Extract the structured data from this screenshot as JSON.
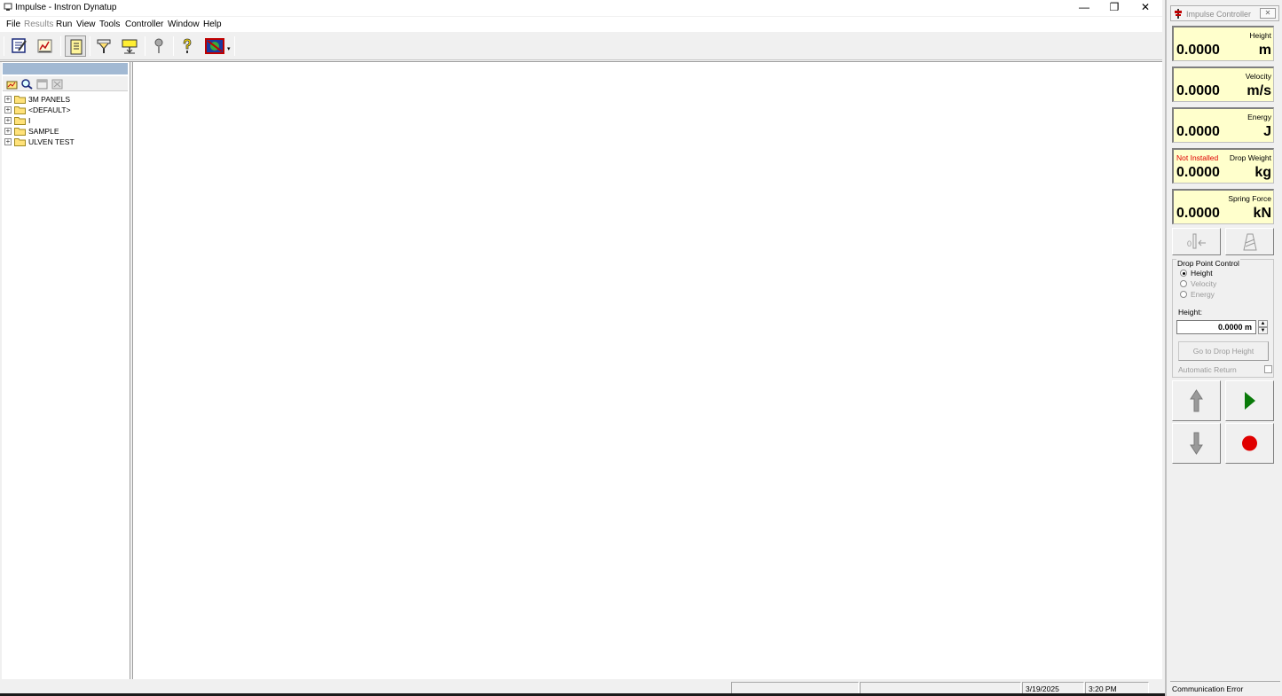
{
  "window": {
    "title": "Impulse - Instron Dynatup",
    "minimize_glyph": "—",
    "restore_glyph": "❐",
    "close_glyph": "✕"
  },
  "menu": {
    "items": [
      "File",
      "Results",
      "Run",
      "View",
      "Tools",
      "Controller",
      "Window",
      "Help"
    ]
  },
  "toolbar": {
    "icons": [
      "edit-method-icon",
      "chart-icon",
      "tree-view-icon",
      "filter-icon",
      "data-transfer-icon",
      "key-icon",
      "help-icon",
      "network-icon"
    ]
  },
  "tree": {
    "items": [
      {
        "label": "3M PANELS"
      },
      {
        "label": "<DEFAULT>"
      },
      {
        "label": "I"
      },
      {
        "label": "SAMPLE"
      },
      {
        "label": "ULVEN TEST"
      }
    ]
  },
  "statusbar": {
    "date": "3/19/2025",
    "time": "3:20 PM"
  },
  "controller": {
    "title": "Impulse Controller",
    "close_glyph": "✕",
    "readouts": [
      {
        "label": "Height",
        "value": "0.0000",
        "unit": "m",
        "status": ""
      },
      {
        "label": "Velocity",
        "value": "0.0000",
        "unit": "m/s",
        "status": ""
      },
      {
        "label": "Energy",
        "value": "0.0000",
        "unit": "J",
        "status": ""
      },
      {
        "label": "Drop Weight",
        "value": "0.0000",
        "unit": "kg",
        "status": "Not Installed"
      },
      {
        "label": "Spring Force",
        "value": "0.0000",
        "unit": "kN",
        "status": ""
      }
    ],
    "drop_point_control": {
      "title": "Drop Point Control",
      "options": [
        {
          "label": "Height",
          "checked": true,
          "enabled": true
        },
        {
          "label": "Velocity",
          "checked": false,
          "enabled": false
        },
        {
          "label": "Energy",
          "checked": false,
          "enabled": false
        }
      ],
      "field_label": "Height:",
      "field_value": "0.0000 m",
      "goto_label": "Go to Drop Height",
      "auto_return_label": "Automatic Return"
    },
    "status": "Communication Error",
    "colors": {
      "readout_bg": "#ffffcc",
      "play": "#0a7a0a",
      "record": "#e00000"
    }
  }
}
